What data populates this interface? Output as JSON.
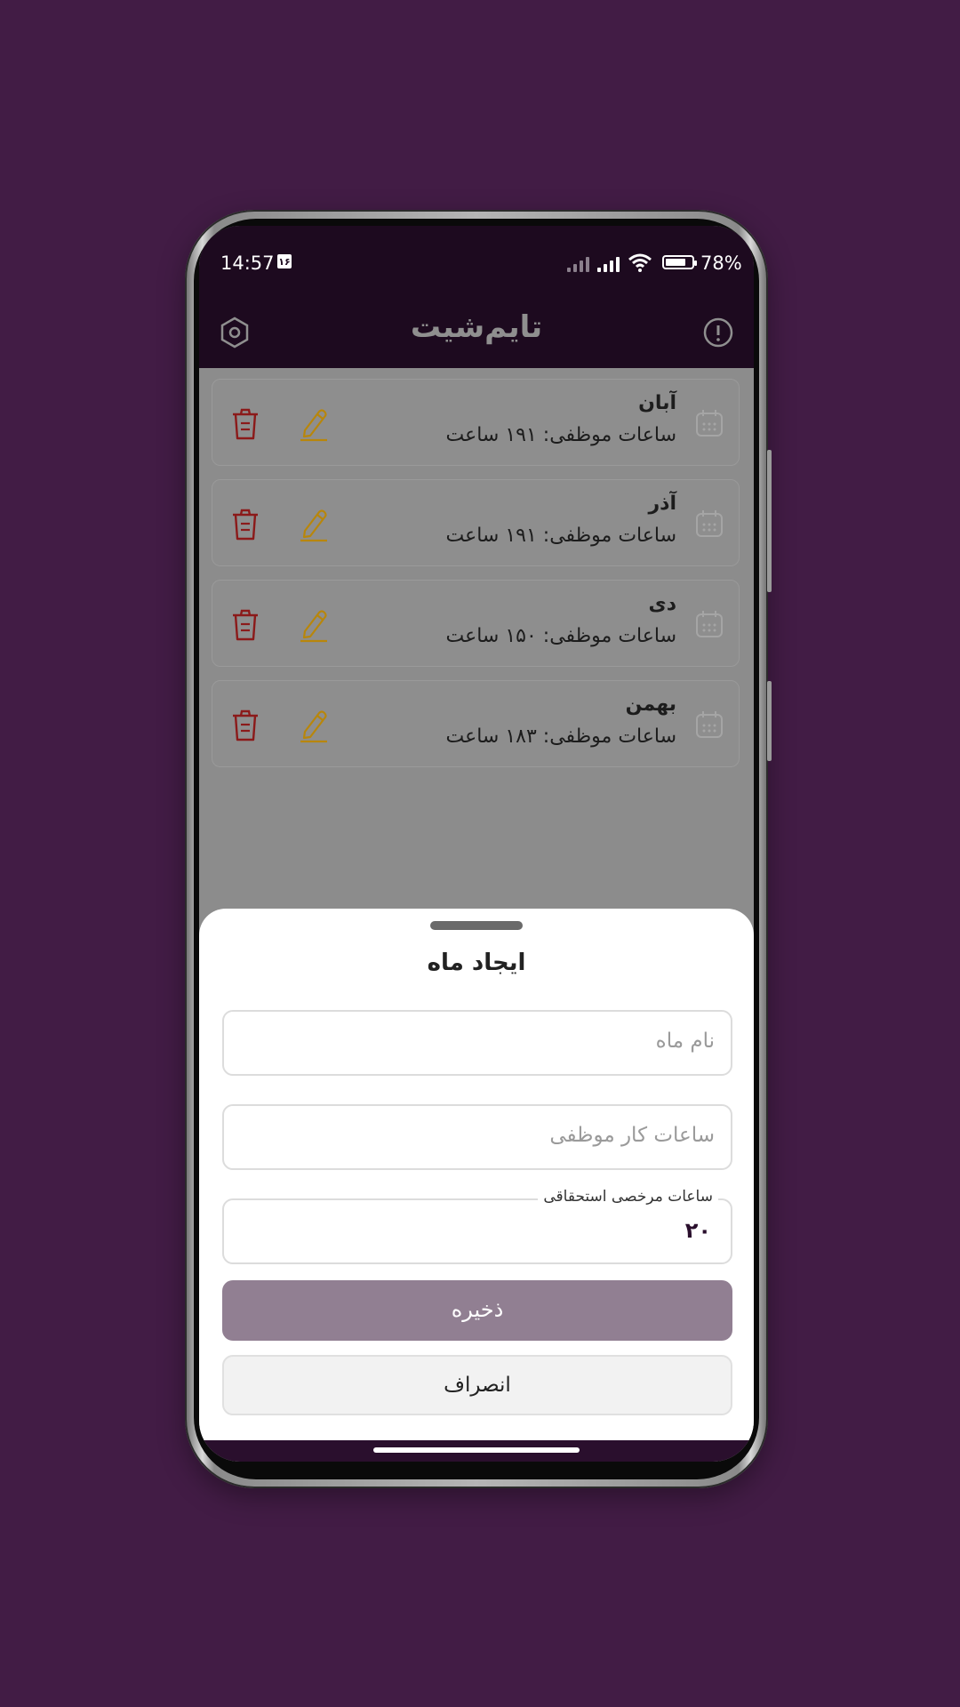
{
  "status_bar": {
    "time": "14:57",
    "calendar_badge": "۱۶",
    "battery_percent": "78%",
    "battery_level": 0.78
  },
  "app_bar": {
    "title": "تایم‌شیت",
    "settings_icon": "settings-hex-icon",
    "info_icon": "info-icon"
  },
  "months": [
    {
      "name": "آبان",
      "hours": "ساعات موظفی: ۱۹۱ ساعت"
    },
    {
      "name": "آذر",
      "hours": "ساعات موظفی: ۱۹۱ ساعت"
    },
    {
      "name": "دی",
      "hours": "ساعات موظفی: ۱۵۰ ساعت"
    },
    {
      "name": "بهمن",
      "hours": "ساعات موظفی: ۱۸۳ ساعت"
    }
  ],
  "sheet": {
    "title": "ایجاد ماه",
    "month_name_placeholder": "نام ماه",
    "work_hours_placeholder": "ساعات کار موظفی",
    "leave_hours_label": "ساعات مرخصی استحقاقی",
    "leave_hours_value": "۲۰",
    "save_label": "ذخیره",
    "cancel_label": "انصراف"
  },
  "colors": {
    "background": "#421c45",
    "appbar": "#1d0a1f",
    "save_button": "#917f92",
    "edit_icon": "#b8860b",
    "delete_icon": "#8b1a1a"
  }
}
